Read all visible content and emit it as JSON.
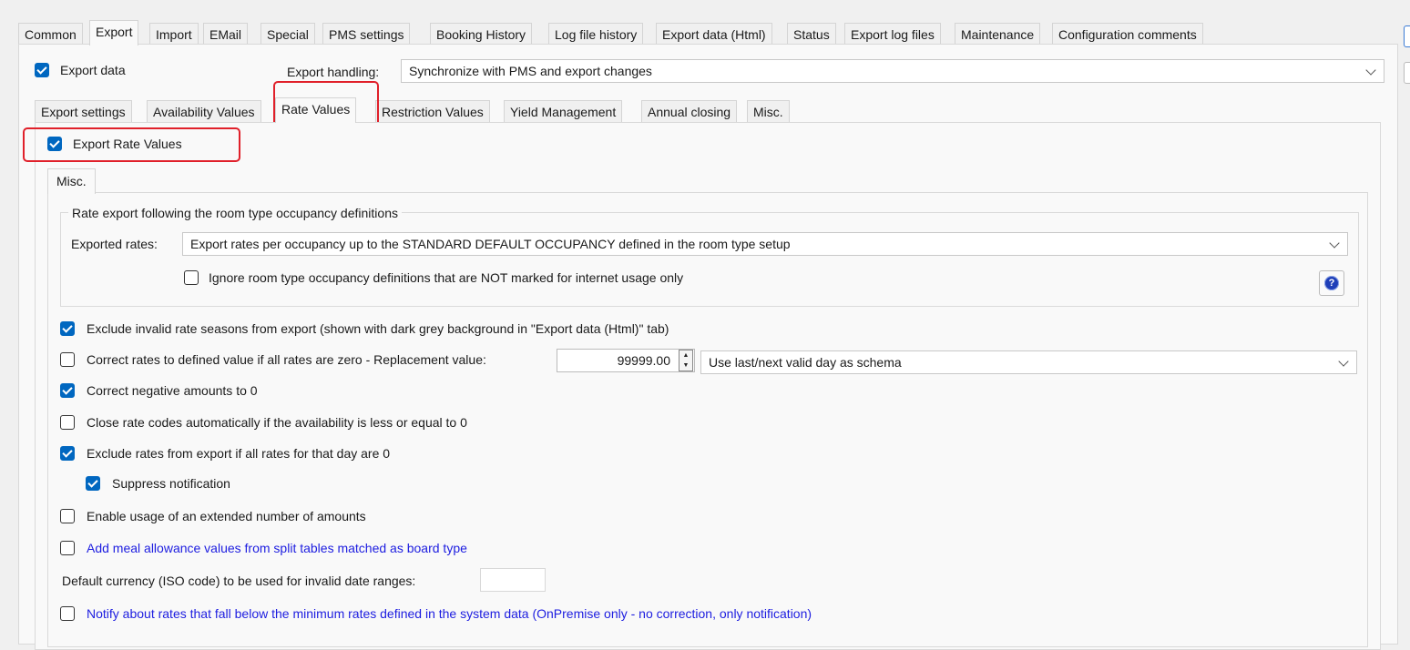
{
  "top_tabs": [
    "Common",
    "Export",
    "Import",
    "EMail",
    "Special",
    "PMS settings",
    "Booking History",
    "Log file history",
    "Export data (Html)",
    "Status",
    "Export log files",
    "Maintenance",
    "Configuration comments"
  ],
  "export_data_label": "Export data",
  "export_handling": {
    "label": "Export handling:",
    "value": "Synchronize with PMS and export changes"
  },
  "sub_tabs": [
    "Export settings",
    "Availability Values",
    "Rate Values",
    "Restriction Values",
    "Yield Management",
    "Annual closing",
    "Misc."
  ],
  "export_rate_values_label": "Export Rate Values",
  "inner_tab": "Misc.",
  "group": {
    "title": "Rate export following the room type occupancy definitions",
    "exported_rates_label": "Exported rates:",
    "exported_rates_value": "Export rates per occupancy up to the STANDARD DEFAULT OCCUPANCY defined in the room type setup",
    "ignore_label": "Ignore room type occupancy definitions that are NOT marked for internet usage only",
    "help_glyph": "?"
  },
  "options": {
    "exclude_invalid": "Exclude invalid rate seasons from export (shown with dark grey background in \"Export data (Html)\" tab)",
    "correct_rates": "Correct rates to defined value if all rates are zero - Replacement value:",
    "replacement_value": "99999.00",
    "schema_value": "Use last/next valid day as schema",
    "correct_negative": "Correct negative amounts to 0",
    "close_rate_codes": "Close rate codes automatically if the availability is less or equal to 0",
    "exclude_zero": "Exclude rates from export if all rates for that day are 0",
    "suppress": "Suppress notification",
    "extended_amounts": "Enable usage of an extended number of amounts",
    "meal_allowance": "Add meal allowance values from split tables matched as board type",
    "default_currency": "Default currency (ISO code) to be used for invalid date ranges:",
    "currency_value": "",
    "notify_rates": "Notify about rates that fall below the minimum rates defined in the system data (OnPremise only - no correction, only notification)"
  },
  "colors": {
    "accent": "#0067c0",
    "highlight": "#e0202a",
    "link_text": "#1d1de0"
  }
}
